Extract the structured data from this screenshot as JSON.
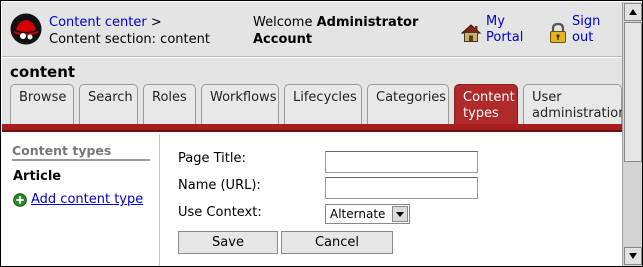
{
  "header": {
    "breadcrumb_link": "Content center",
    "breadcrumb_sep": ">",
    "breadcrumb_section": "Content section: content",
    "welcome_prefix": "Welcome",
    "welcome_user": "Administrator",
    "welcome_suffix": "Account",
    "my_portal_label_1": "My",
    "my_portal_label_2": "Portal",
    "sign_out_label_1": "Sign",
    "sign_out_label_2": "out"
  },
  "page_title": "content",
  "tabs": [
    {
      "label_1": "Browse",
      "label_2": ""
    },
    {
      "label_1": "Search",
      "label_2": ""
    },
    {
      "label_1": "Roles",
      "label_2": ""
    },
    {
      "label_1": "Workflows",
      "label_2": ""
    },
    {
      "label_1": "Lifecycles",
      "label_2": ""
    },
    {
      "label_1": "Categories",
      "label_2": ""
    },
    {
      "label_1": "Content",
      "label_2": "types",
      "active": true
    },
    {
      "label_1": "User",
      "label_2": "administration"
    }
  ],
  "sidebar": {
    "heading": "Content types",
    "items": [
      {
        "label": "Article"
      }
    ],
    "add_link": "Add content type"
  },
  "form": {
    "page_title_label": "Page Title:",
    "page_title_value": "",
    "name_label": "Name (URL):",
    "name_value": "",
    "use_context_label": "Use Context:",
    "use_context_selected": "Alternate",
    "save_label": "Save",
    "cancel_label": "Cancel"
  },
  "colors": {
    "accent_red": "#b02a2a",
    "link_blue": "#0000cc",
    "header_gray": "#e4e4e4"
  },
  "icons": {
    "logo": "redhat-logo",
    "my_portal": "house-icon",
    "sign_out": "padlock-icon",
    "add": "plus-circle-icon"
  }
}
